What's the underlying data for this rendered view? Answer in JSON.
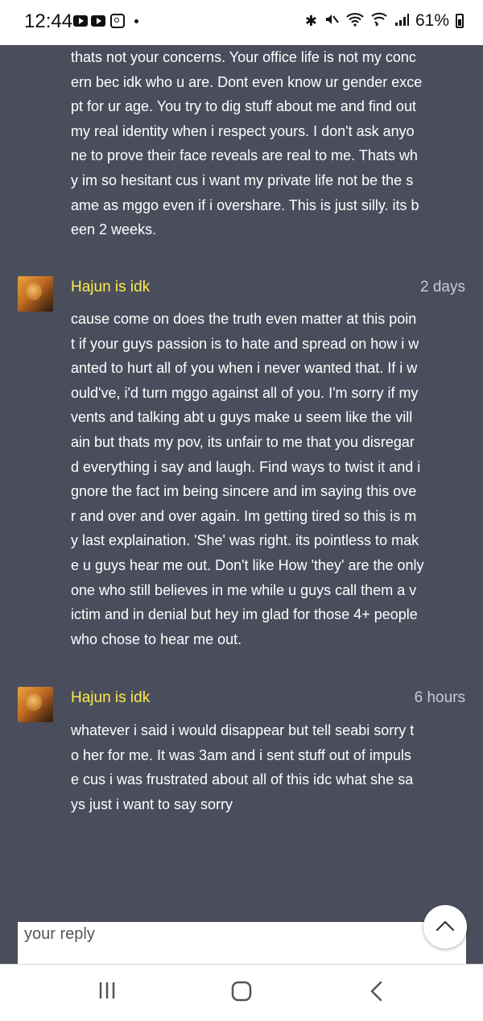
{
  "status_bar": {
    "time": "12:44",
    "battery": "61%",
    "icons": [
      "youtube-icon",
      "youtube-icon",
      "instagram-icon",
      "bluetooth-icon",
      "mute-icon",
      "wifi-icon",
      "wifi-calling-icon",
      "signal-icon",
      "battery-icon"
    ]
  },
  "messages": [
    {
      "lines": [
        "thats not your concerns. Your office life is not my conc",
        "ern bec idk who u are. Dont even know ur gender exce",
        "pt for ur age. You try to dig stuff about me and find out",
        " my real identity when i respect yours. I don't ask anyo",
        "ne to prove their face reveals are real to me. Thats wh",
        "y im so hesitant cus i want my private life not be the s",
        "ame as mggo even if i overshare. This is just silly. its b",
        "een 2 weeks."
      ]
    },
    {
      "author": "Hajun is idk",
      "time": "2 days",
      "lines": [
        "cause come on does the truth even matter at this poin",
        "t if your guys passion is to hate and spread on how i w",
        "anted to hurt all of you when i never wanted that. If i w",
        "ould've, i'd turn mggo against all of you. I'm sorry if my",
        " vents and talking abt u guys make u seem like the vill",
        "ain but thats my pov, its unfair to me that you disregar",
        "d everything i say and laugh. Find ways to twist it and i",
        "gnore the fact im being sincere and im saying this ove",
        "r and over and over again. Im getting tired so this is m",
        "y last explaination. 'She' was right. its pointless to mak",
        "e u guys hear me out. Don't like How 'they' are the only",
        " one who still believes in me while u guys call them a v",
        "ictim and in denial but hey im glad for those 4+ people",
        " who chose to hear me out."
      ]
    },
    {
      "author": "Hajun is idk",
      "time": "6 hours",
      "lines": [
        "whatever i said i would disappear but tell seabi sorry t",
        "o her for me. It was 3am and i sent stuff out of impuls",
        "e cus i was frustrated about all of this idc what she sa",
        "ys just i want to say sorry"
      ]
    }
  ],
  "reply": {
    "placeholder": "your reply"
  },
  "colors": {
    "background": "#4a4e5c",
    "username": "#ffe94a",
    "timestamp": "#c9cbd1"
  }
}
